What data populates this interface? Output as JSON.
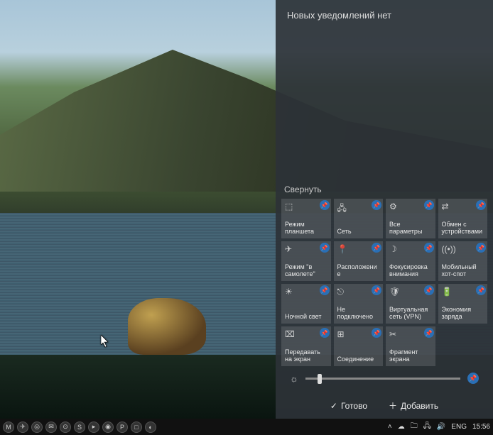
{
  "action_center": {
    "header": "Новых уведомлений нет",
    "collapse": "Свернуть",
    "tiles": [
      {
        "icon": "⬚",
        "label": "Режим планшета"
      },
      {
        "icon": "🖧",
        "label": "Сеть"
      },
      {
        "icon": "⚙",
        "label": "Все параметры"
      },
      {
        "icon": "⇄",
        "label": "Обмен с устройствами"
      },
      {
        "icon": "✈",
        "label": "Режим \"в самолете\""
      },
      {
        "icon": "📍",
        "label": "Расположение"
      },
      {
        "icon": "☽",
        "label": "Фокусировка внимания"
      },
      {
        "icon": "((•))",
        "label": "Мобильный хот-спот"
      },
      {
        "icon": "☀",
        "label": "Ночной свет"
      },
      {
        "icon": "⎋",
        "label": "Не подключено"
      },
      {
        "icon": "🛡",
        "label": "Виртуальная сеть (VPN)"
      },
      {
        "icon": "🔋",
        "label": "Экономия заряда"
      },
      {
        "icon": "⌧",
        "label": "Передавать на экран"
      },
      {
        "icon": "⊞",
        "label": "Соединение"
      },
      {
        "icon": "✂",
        "label": "Фрагмент экрана"
      }
    ],
    "footer_done": "Готово",
    "footer_add": "Добавить"
  },
  "taskbar": {
    "left_icons": [
      "M",
      "✈",
      "◎",
      "✉",
      "⊙",
      "S",
      "▸",
      "◉",
      "P",
      "□",
      "◐"
    ],
    "tray": {
      "chevron": "˄",
      "cloud": "☁",
      "folder": "🗀",
      "net": "🖧",
      "vol": "🔊"
    },
    "lang": "ENG",
    "time": "15:56"
  }
}
